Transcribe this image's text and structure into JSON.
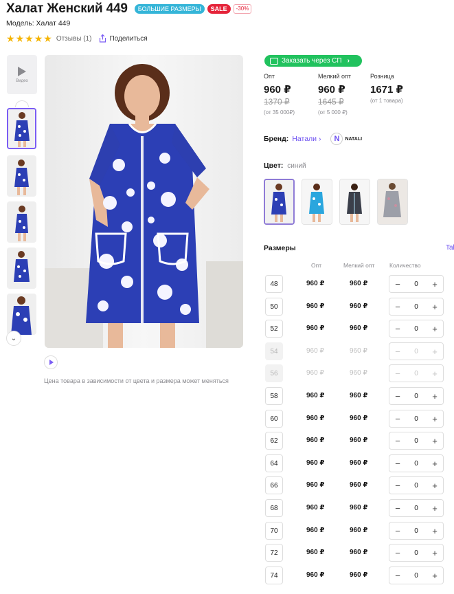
{
  "product": {
    "title": "Халат Женский 449",
    "badges": {
      "big_sizes": "БОЛЬШИЕ РАЗМЕРЫ",
      "sale": "SALE",
      "discount": "-30%"
    },
    "model": "Модель: Халат 449",
    "rating": {
      "stars": 5,
      "reviews": "Отзывы (1)"
    },
    "share": "Поделиться"
  },
  "gallery": {
    "video_label": "Видео",
    "note": "Цена товара в зависимости от цвета и размера может меняться"
  },
  "order": {
    "label": "Заказать через СП",
    "chevron": "›"
  },
  "prices": [
    {
      "label": "Опт",
      "price": "960 ₽",
      "old": "1370 ₽",
      "note": "(от 35 000₽)"
    },
    {
      "label": "Мелкий опт",
      "price": "960 ₽",
      "old": "1645 ₽",
      "note": "(от 5 000 ₽)"
    },
    {
      "label": "Розница",
      "price": "1671 ₽",
      "old": "",
      "note": "(от 1 товара)"
    }
  ],
  "brand": {
    "label": "Бренд:",
    "name": "Натали",
    "chevron": "›",
    "logo_text": "NATALI",
    "logo_letter": "N"
  },
  "color": {
    "label": "Цвет:",
    "value": "синий"
  },
  "sizes": {
    "title": "Размеры",
    "table_link": "Tab",
    "headers": {
      "opt": "Опт",
      "small_opt": "Мелкий опт",
      "qty": "Количество"
    },
    "rows": [
      {
        "size": "48",
        "opt": "960 ₽",
        "small": "960 ₽",
        "qty": "0",
        "available": true
      },
      {
        "size": "50",
        "opt": "960 ₽",
        "small": "960 ₽",
        "qty": "0",
        "available": true
      },
      {
        "size": "52",
        "opt": "960 ₽",
        "small": "960 ₽",
        "qty": "0",
        "available": true
      },
      {
        "size": "54",
        "opt": "960 ₽",
        "small": "960 ₽",
        "qty": "0",
        "available": false
      },
      {
        "size": "56",
        "opt": "960 ₽",
        "small": "960 ₽",
        "qty": "0",
        "available": false
      },
      {
        "size": "58",
        "opt": "960 ₽",
        "small": "960 ₽",
        "qty": "0",
        "available": true
      },
      {
        "size": "60",
        "opt": "960 ₽",
        "small": "960 ₽",
        "qty": "0",
        "available": true
      },
      {
        "size": "62",
        "opt": "960 ₽",
        "small": "960 ₽",
        "qty": "0",
        "available": true
      },
      {
        "size": "64",
        "opt": "960 ₽",
        "small": "960 ₽",
        "qty": "0",
        "available": true
      },
      {
        "size": "66",
        "opt": "960 ₽",
        "small": "960 ₽",
        "qty": "0",
        "available": true
      },
      {
        "size": "68",
        "opt": "960 ₽",
        "small": "960 ₽",
        "qty": "0",
        "available": true
      },
      {
        "size": "70",
        "opt": "960 ₽",
        "small": "960 ₽",
        "qty": "0",
        "available": true
      },
      {
        "size": "72",
        "opt": "960 ₽",
        "small": "960 ₽",
        "qty": "0",
        "available": true
      },
      {
        "size": "74",
        "opt": "960 ₽",
        "small": "960 ₽",
        "qty": "0",
        "available": true
      }
    ],
    "minus": "−",
    "plus": "+"
  },
  "colors": {
    "accent": "#7a5cf4",
    "green": "#21c25e",
    "dress_blue": "#2c3fb5"
  }
}
